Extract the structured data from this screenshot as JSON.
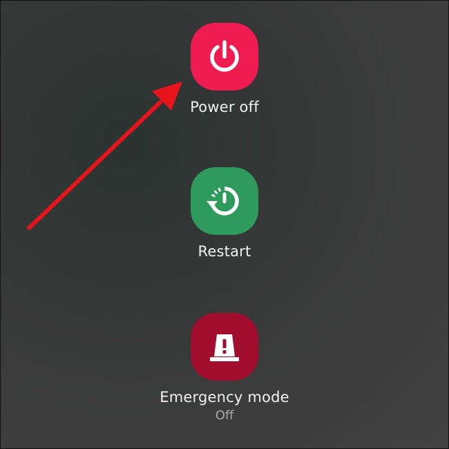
{
  "colors": {
    "power_off": "#ef1c52",
    "restart": "#2e9a5b",
    "emergency": "#a00d2d",
    "arrow": "#e8141b"
  },
  "menu": {
    "power_off": {
      "label": "Power off",
      "icon": "power-icon"
    },
    "restart": {
      "label": "Restart",
      "icon": "restart-icon"
    },
    "emergency": {
      "label": "Emergency mode",
      "status": "Off",
      "icon": "emergency-light-icon"
    }
  },
  "annotation": {
    "type": "arrow",
    "target": "power_off"
  }
}
